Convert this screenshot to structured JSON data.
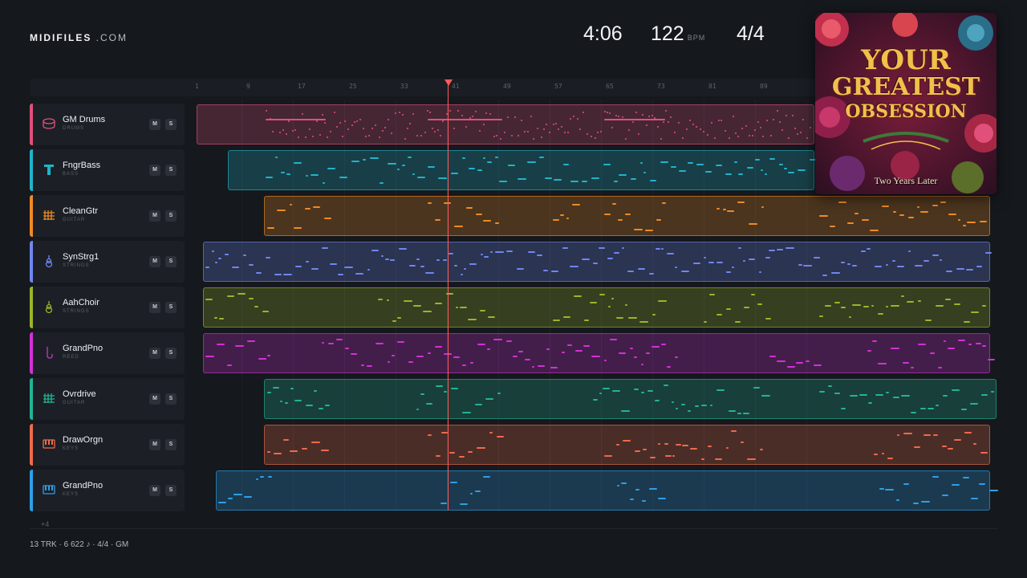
{
  "header": {
    "logo_bold": "MIDIFILES",
    "logo_light": " .COM",
    "duration": "4:06",
    "tempo": "122",
    "tempo_unit": "BPM",
    "time_signature": "4/4"
  },
  "ruler": {
    "bars": [
      "1",
      "9",
      "17",
      "25",
      "33",
      "41",
      "49",
      "57",
      "65",
      "73",
      "81",
      "89"
    ]
  },
  "tracks": [
    {
      "name": "GM Drums",
      "category": "DRUMS",
      "color": "#e0507a",
      "icon": "drum-icon",
      "mute": "M",
      "solo": "S"
    },
    {
      "name": "FngrBass",
      "category": "BASS",
      "color": "#22b3c9",
      "icon": "bass-icon",
      "mute": "M",
      "solo": "S"
    },
    {
      "name": "CleanGtr",
      "category": "GUITAR",
      "color": "#f08a24",
      "icon": "guitar-fretboard-icon",
      "mute": "M",
      "solo": "S"
    },
    {
      "name": "SynStrg1",
      "category": "STRINGS",
      "color": "#6f86f0",
      "icon": "violin-icon",
      "mute": "M",
      "solo": "S"
    },
    {
      "name": "AahChoir",
      "category": "STRINGS",
      "color": "#9ab52a",
      "icon": "violin-icon",
      "mute": "M",
      "solo": "S"
    },
    {
      "name": "GrandPno",
      "category": "REED",
      "color": "#d231d6",
      "icon": "saxophone-icon",
      "mute": "M",
      "solo": "S"
    },
    {
      "name": "Ovrdrive",
      "category": "GUITAR",
      "color": "#23b394",
      "icon": "guitar-fretboard-icon",
      "mute": "M",
      "solo": "S"
    },
    {
      "name": "DrawOrgn",
      "category": "KEYS",
      "color": "#ef6a4a",
      "icon": "keyboard-icon",
      "mute": "M",
      "solo": "S"
    },
    {
      "name": "GrandPno",
      "category": "KEYS",
      "color": "#2f9ee6",
      "icon": "keyboard-icon",
      "mute": "M",
      "solo": "S"
    }
  ],
  "more_tracks": "+4",
  "footer": {
    "text": "13 TRK   ·   6 622 ♪   ·   4/4   ·   GM"
  },
  "album": {
    "title_line1": "YOUR",
    "title_line2": "GREATEST",
    "title_line3": "OBSESSION",
    "subtitle": "Two Years Later"
  }
}
